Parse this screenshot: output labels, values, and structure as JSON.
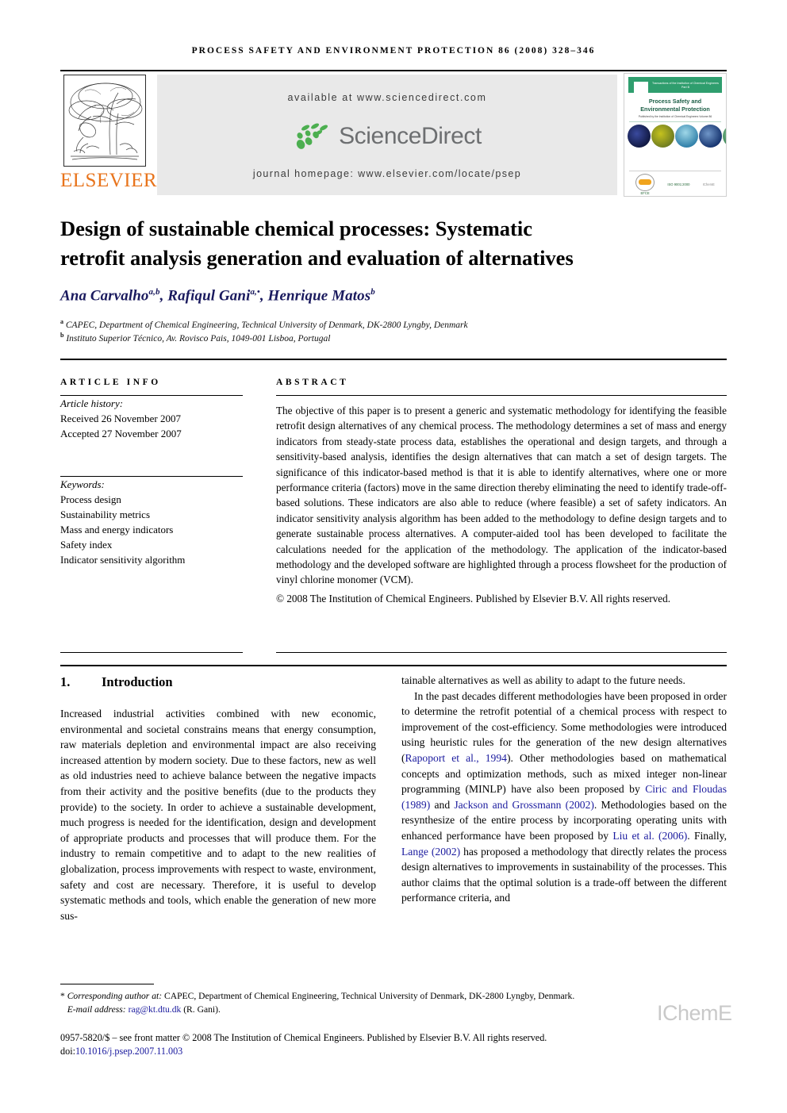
{
  "running_head": "process safety and environment protection 86 (2008) 328–346",
  "header": {
    "publisher_name": "ELSEVIER",
    "available_at": "available at www.sciencedirect.com",
    "sciencedirect_wordmark": "ScienceDirect",
    "journal_homepage": "journal homepage: www.elsevier.com/locate/psep"
  },
  "cover": {
    "banner_text": "Transactions of the Institution of Chemical Engineers Part B",
    "title_line1": "Process Safety and",
    "title_line2": "Environmental Protection",
    "subtitle": "Published by the Institution of Chemical Engineers  Volume 86",
    "badge_efce": "EFCE",
    "badge_iso": "ISO 9001:2000",
    "badge_icheme": "IChemE"
  },
  "article": {
    "title_line1": "Design of sustainable chemical processes: Systematic",
    "title_line2": "retrofit analysis generation and evaluation of alternatives",
    "authors_html": "Ana Carvalho<sup>a,b</sup>, Rafiqul Gani<sup>a,•</sup>, Henrique Matos<sup>b</sup>",
    "affiliation_a": "CAPEC, Department of Chemical Engineering, Technical University of Denmark, DK-2800 Lyngby, Denmark",
    "affiliation_b": "Instituto Superior Técnico, Av. Rovisco Pais, 1049-001 Lisboa, Portugal",
    "affiliation_a_marker": "a",
    "affiliation_b_marker": "b"
  },
  "article_info": {
    "heading": "article info",
    "history_label": "Article history:",
    "received": "Received 26 November 2007",
    "accepted": "Accepted 27 November 2007",
    "keywords_label": "Keywords:",
    "keywords": [
      "Process design",
      "Sustainability metrics",
      "Mass and energy indicators",
      "Safety index",
      "Indicator sensitivity algorithm"
    ]
  },
  "abstract": {
    "heading": "abstract",
    "text": "The objective of this paper is to present a generic and systematic methodology for identifying the feasible retrofit design alternatives of any chemical process. The methodology determines a set of mass and energy indicators from steady-state process data, establishes the operational and design targets, and through a sensitivity-based analysis, identifies the design alternatives that can match a set of design targets. The significance of this indicator-based method is that it is able to identify alternatives, where one or more performance criteria (factors) move in the same direction thereby eliminating the need to identify trade-off-based solutions. These indicators are also able to reduce (where feasible) a set of safety indicators. An indicator sensitivity analysis algorithm has been added to the methodology to define design targets and to generate sustainable process alternatives. A computer-aided tool has been developed to facilitate the calculations needed for the application of the methodology. The application of the indicator-based methodology and the developed software are highlighted through a process flowsheet for the production of vinyl chlorine monomer (VCM).",
    "copyright": "© 2008 The Institution of Chemical Engineers. Published by Elsevier B.V. All rights reserved."
  },
  "body": {
    "section_number": "1.",
    "section_title": "Introduction",
    "left_paragraph": "Increased industrial activities combined with new economic, environmental and societal constrains means that energy consumption, raw materials depletion and environmental impact are also receiving increased attention by modern society. Due to these factors, new as well as old industries need to achieve balance between the negative impacts from their activity and the positive benefits (due to the products they provide) to the society. In order to achieve a sustainable development, much progress is needed for the identification, design and development of appropriate products and processes that will produce them. For the industry to remain competitive and to adapt to the new realities of globalization, process improvements with respect to waste, environment, safety and cost are necessary. Therefore, it is useful to develop systematic methods and tools, which enable the generation of new more sus-",
    "right_paragraph_1": "tainable alternatives as well as ability to adapt to the future needs.",
    "right_paragraph_2_a": "In the past decades different methodologies have been proposed in order to determine the retrofit potential of a chemical process with respect to improvement of the cost-efficiency. Some methodologies were introduced using heuristic rules for the generation of the new design alternatives (",
    "ref_1": "Rapoport et al., 1994",
    "right_paragraph_2_b": "). Other methodologies based on mathematical concepts and optimization methods, such as mixed integer non-linear programming (MINLP) have also been proposed by ",
    "ref_2": "Ciric and Floudas (1989)",
    "right_paragraph_2_c": " and ",
    "ref_3": "Jackson and Grossmann (2002)",
    "right_paragraph_2_d": ". Methodologies based on the resynthesize of the entire process by incorporating operating units with enhanced performance have been proposed by ",
    "ref_4": "Liu et al. (2006)",
    "right_paragraph_2_e": ". Finally, ",
    "ref_5": "Lange (2002)",
    "right_paragraph_2_f": " has proposed a methodology that directly relates the process design alternatives to improvements in sustainability of the processes. This author claims that the optimal solution is a trade-off between the different performance criteria, and"
  },
  "footer": {
    "corresponding_marker": "*",
    "corresponding_label": "Corresponding author at:",
    "corresponding_text": " CAPEC, Department of Chemical Engineering, Technical University of Denmark, DK-2800 Lyngby, Denmark.",
    "email_label": "E-mail address:",
    "email_value": "rag@kt.dtu.dk",
    "email_suffix": " (R. Gani).",
    "issn_line": "0957-5820/$ – see front matter © 2008 The Institution of Chemical Engineers. Published by Elsevier B.V. All rights reserved.",
    "doi_label": "doi:",
    "doi_value": "10.1016/j.psep.2007.11.003",
    "icheme_mark": "IChemE"
  },
  "colors": {
    "elsevier_orange": "#e8741c",
    "sciencedirect_green": "#4caf50",
    "sciencedirect_grey": "#6d6f71",
    "band_grey": "#e9e9e9",
    "link_blue": "#1a1a9e",
    "author_navy": "#1a1a5e",
    "cover_green": "#2f9e6e"
  }
}
